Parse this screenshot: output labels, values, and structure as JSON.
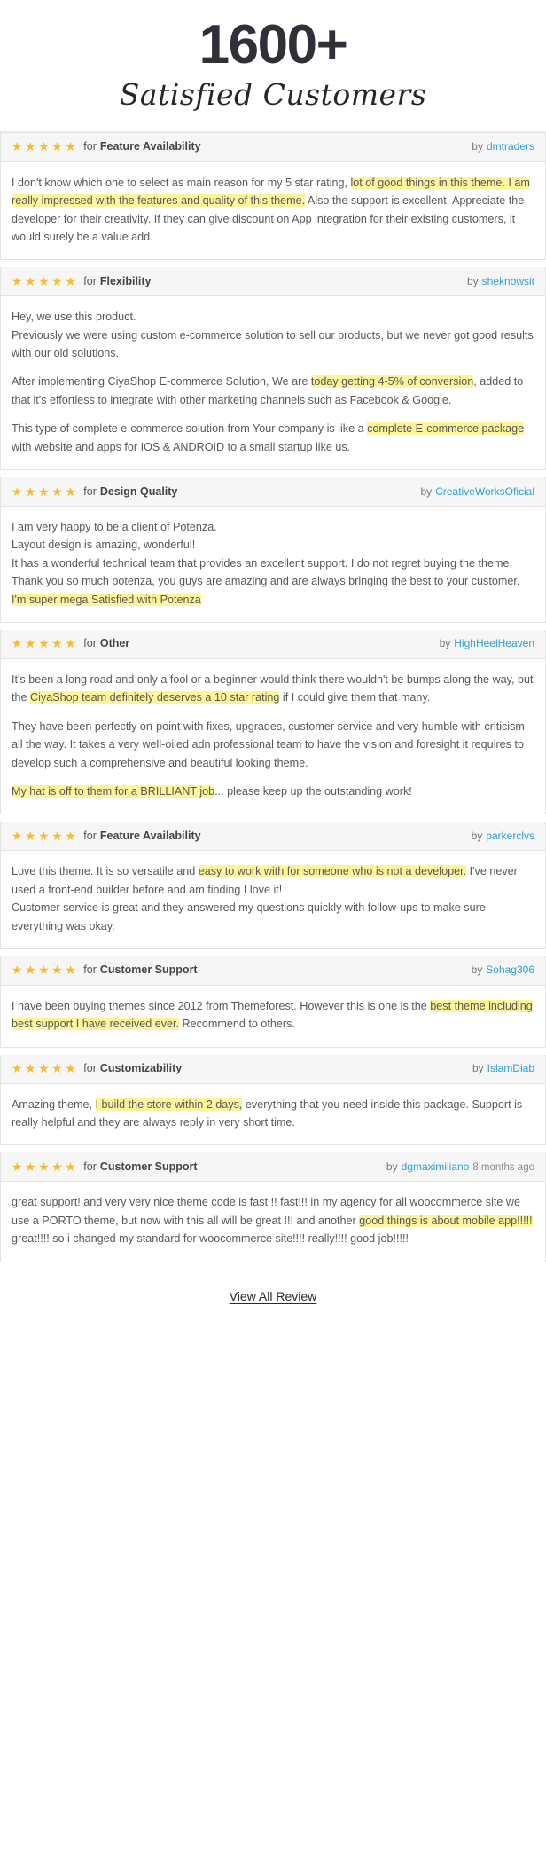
{
  "hero": {
    "count": "1600+",
    "subtitle": "Satisfied Customers"
  },
  "labels": {
    "for": "for",
    "by": "by",
    "stars": "★★★★★"
  },
  "colors": {
    "star": "#f5bc31",
    "author_link": "#2e9fd4",
    "highlight": "#fcf59b",
    "card_header_bg": "#f6f6f6",
    "border": "#e4e4e4",
    "heading": "#2f3038"
  },
  "reviews": [
    {
      "rating": 5,
      "stars": "★★★★★",
      "subject": "Feature Availability",
      "author": "dmtraders",
      "time": "",
      "paragraphs": [
        [
          {
            "t": "I don't know which one to select as main reason for my 5 star rating, ",
            "h": false
          },
          {
            "t": "lot of good things in this theme. I am really impressed with the features and quality of this theme.",
            "h": true
          },
          {
            "t": " Also the support is excellent. Appreciate the developer for their creativity. If they can give discount on App integration for their existing customers, it would surely be a value add.",
            "h": false
          }
        ]
      ]
    },
    {
      "rating": 5,
      "stars": "★★★★★",
      "subject": "Flexibility",
      "author": "sheknowsit",
      "time": "",
      "paragraphs": [
        [
          {
            "t": "Hey, we use this product.",
            "h": false,
            "br": true
          },
          {
            "t": "Previously we were using custom e-commerce solution to sell our products, but we never got good results with our old solutions.",
            "h": false
          }
        ],
        [
          {
            "t": "After implementing CiyaShop E-commerce Solution, We are ",
            "h": false
          },
          {
            "t": "today getting 4-5% of conversion",
            "h": true
          },
          {
            "t": ", added to that it's effortless to integrate with other marketing channels such as Facebook & Google.",
            "h": false
          }
        ],
        [
          {
            "t": "This type of complete e-commerce solution from Your company is like a ",
            "h": false
          },
          {
            "t": "complete E-commerce package",
            "h": true
          },
          {
            "t": " with website and apps for IOS & ANDROID to a small startup like us.",
            "h": false
          }
        ]
      ]
    },
    {
      "rating": 5,
      "stars": "★★★★★",
      "subject": "Design Quality",
      "author": "CreativeWorksOficial",
      "time": "",
      "paragraphs": [
        [
          {
            "t": "I am very happy to be a client of Potenza.",
            "h": false,
            "br": true
          },
          {
            "t": "Layout design is amazing, wonderful!",
            "h": false,
            "br": true
          },
          {
            "t": "It has a wonderful technical team that provides an excellent support. I do not regret buying the theme. Thank you so much potenza, you guys are amazing and are always bringing the best to your customer. ",
            "h": false
          },
          {
            "t": "I'm super mega Satisfied with Potenza",
            "h": true
          }
        ]
      ]
    },
    {
      "rating": 5,
      "stars": "★★★★★",
      "subject": "Other",
      "author": "HighHeelHeaven",
      "time": "",
      "paragraphs": [
        [
          {
            "t": "It's been a long road and only a fool or a beginner would think there wouldn't be bumps along the way, but the ",
            "h": false
          },
          {
            "t": "CiyaShop team definitely deserves a 10 star rating",
            "h": true
          },
          {
            "t": " if I could give them that many.",
            "h": false
          }
        ],
        [
          {
            "t": "They have been perfectly on-point with fixes, upgrades, customer service and very humble with criticism all the way. It takes a very well-oiled adn professional team to have the vision and foresight it requires to develop such a comprehensive and beautiful looking theme.",
            "h": false
          }
        ],
        [
          {
            "t": "My hat is off to them for a BRILLIANT job",
            "h": true
          },
          {
            "t": "... please keep up the outstanding work!",
            "h": false
          }
        ]
      ]
    },
    {
      "rating": 5,
      "stars": "★★★★★",
      "subject": "Feature Availability",
      "author": "parkerclvs",
      "time": "",
      "paragraphs": [
        [
          {
            "t": "Love this theme. It is so versatile and ",
            "h": false
          },
          {
            "t": "easy to work with for someone who is not a developer.",
            "h": true
          },
          {
            "t": " I've never used a front-end builder before and am finding I love it!",
            "h": false,
            "br": true
          },
          {
            "t": "Customer service is great and they answered my questions quickly with follow-ups to make sure everything was okay.",
            "h": false
          }
        ]
      ]
    },
    {
      "rating": 5,
      "stars": "★★★★★",
      "subject": "Customer Support",
      "author": "Sohag306",
      "time": "",
      "paragraphs": [
        [
          {
            "t": "I have been buying themes since 2012 from Themeforest. However this is one is the ",
            "h": false
          },
          {
            "t": "best theme including best support I have received ever.",
            "h": true
          },
          {
            "t": " Recommend to others.",
            "h": false
          }
        ]
      ]
    },
    {
      "rating": 5,
      "stars": "★★★★★",
      "subject": "Customizability",
      "author": "IslamDiab",
      "time": "",
      "paragraphs": [
        [
          {
            "t": "Amazing theme, ",
            "h": false
          },
          {
            "t": "I build the store within 2 days,",
            "h": true
          },
          {
            "t": " everything that you need inside this package. Support is really helpful and they are always reply in very short time.",
            "h": false
          }
        ]
      ]
    },
    {
      "rating": 5,
      "stars": "★★★★★",
      "subject": "Customer Support",
      "author": "dgmaximiliano",
      "time": "8 months ago",
      "paragraphs": [
        [
          {
            "t": "great support! and very very nice theme code is fast !! fast!!! in my agency for all woocommerce site we use a PORTO theme, but now with this all will be great !!! and another ",
            "h": false
          },
          {
            "t": "good things is about mobile app!!!!!",
            "h": true
          },
          {
            "t": " great!!!! so i changed my standard for woocommerce site!!!! really!!!! good job!!!!!",
            "h": false
          }
        ]
      ]
    }
  ],
  "footer": {
    "view_all_label": "View All Review"
  }
}
